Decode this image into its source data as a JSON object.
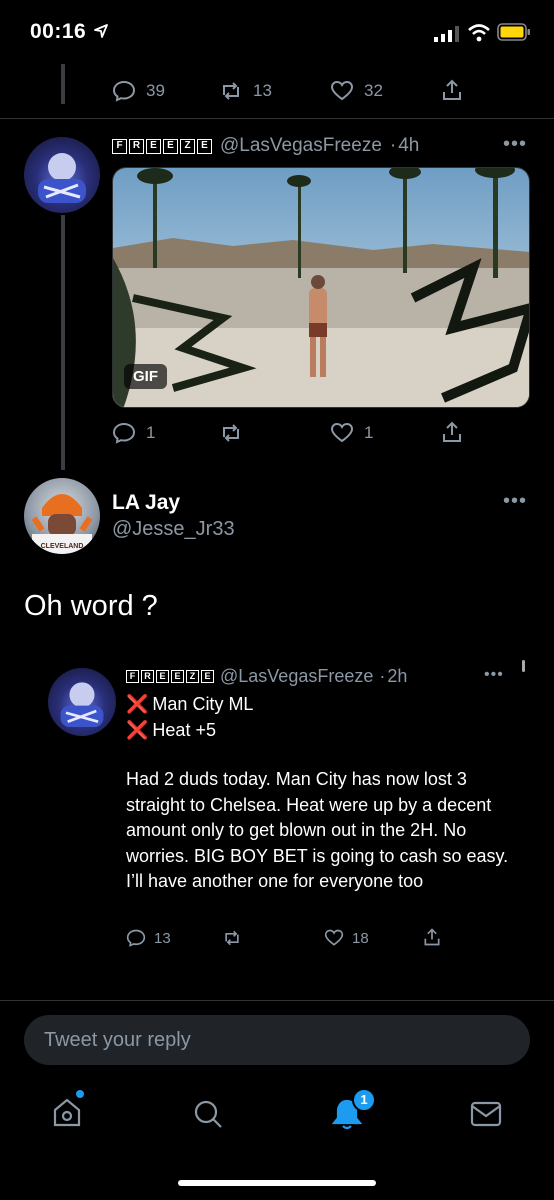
{
  "status_bar": {
    "time": "00:16"
  },
  "parent_tweet": {
    "reply_count": "39",
    "retweet_count": "13",
    "like_count": "32"
  },
  "freeze_tweet": {
    "badge_letters": [
      "F",
      "R",
      "E",
      "E",
      "Z",
      "E"
    ],
    "handle": "@LasVegasFreeze",
    "time": "4h",
    "media_label": "GIF",
    "reply_count": "1",
    "retweet_count": "",
    "like_count": "1"
  },
  "main_tweet": {
    "name": "LA Jay",
    "handle": "@Jesse_Jr33",
    "text": "Oh word ?",
    "avatar_text": "CLEVELAND"
  },
  "quoted_tweet": {
    "badge_letters": [
      "F",
      "R",
      "E",
      "E",
      "Z",
      "E"
    ],
    "handle": "@LasVegasFreeze",
    "time": "2h",
    "lines": [
      {
        "mark": "❌",
        "text": "Man City ML"
      },
      {
        "mark": "❌",
        "text": "Heat +5"
      }
    ],
    "body": "Had 2 duds today. Man City has now lost 3 straight to Chelsea. Heat were up by a decent amount only to get blown out in the 2H. No worries. BIG BOY BET is going to cash so easy. I’ll have another one for everyone too",
    "reply_count": "13",
    "like_count": "18"
  },
  "reply_bar": {
    "placeholder": "Tweet your reply"
  },
  "tab_bar": {
    "notifications_badge": "1"
  },
  "colors": {
    "accent": "#1d9bf0",
    "muted": "#8b98a5",
    "background": "#000000",
    "input_bg": "#202327"
  }
}
